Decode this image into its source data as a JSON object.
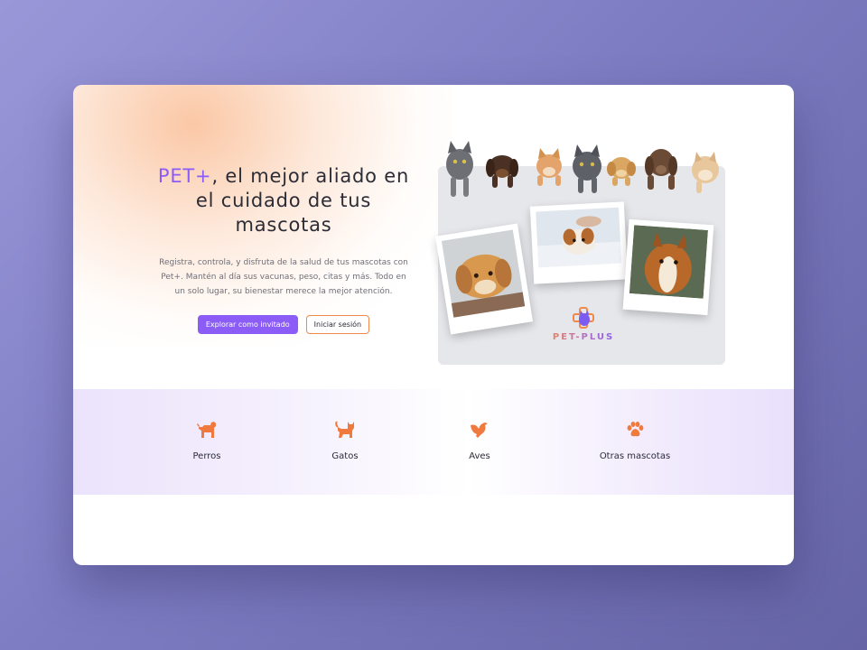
{
  "hero": {
    "brand": "PET+",
    "title_rest": ", el mejor aliado en el cuidado de tus mascotas",
    "description": "Registra, controla, y disfruta de la salud de tus mascotas con Pet+. Mantén al día sus vacunas, peso, citas y más. Todo en un solo lugar, su bienestar merece la mejor atención.",
    "primary_button": "Explorar como invitado",
    "secondary_button": "Iniciar sesión"
  },
  "illustration": {
    "logo_text": "PET-PLUS"
  },
  "categories": [
    {
      "label": "Perros",
      "icon": "dog-icon"
    },
    {
      "label": "Gatos",
      "icon": "cat-icon"
    },
    {
      "label": "Aves",
      "icon": "bird-icon"
    },
    {
      "label": "Otras mascotas",
      "icon": "paw-icon"
    }
  ],
  "colors": {
    "brand_purple": "#8b5cf6",
    "accent_orange": "#f08a4b",
    "text_dark": "#2c2c36"
  }
}
